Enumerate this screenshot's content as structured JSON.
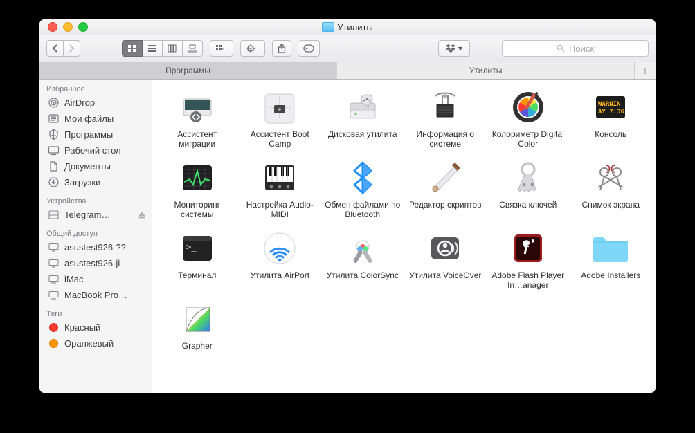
{
  "window_title": "Утилиты",
  "search": {
    "placeholder": "Поиск"
  },
  "tabs": [
    {
      "label": "Программы",
      "active": false
    },
    {
      "label": "Утилиты",
      "active": true
    }
  ],
  "sidebar": {
    "sections": [
      {
        "title": "Избранное",
        "items": [
          {
            "icon": "airdrop",
            "label": "AirDrop"
          },
          {
            "icon": "myfiles",
            "label": "Мои файлы"
          },
          {
            "icon": "apps",
            "label": "Программы"
          },
          {
            "icon": "desktop",
            "label": "Рабочий стол"
          },
          {
            "icon": "docs",
            "label": "Документы"
          },
          {
            "icon": "downloads",
            "label": "Загрузки"
          }
        ]
      },
      {
        "title": "Устройства",
        "items": [
          {
            "icon": "disk",
            "label": "Telegram…",
            "eject": true
          }
        ]
      },
      {
        "title": "Общий доступ",
        "items": [
          {
            "icon": "host",
            "label": "asustest926-??"
          },
          {
            "icon": "host",
            "label": "asustest926-ji"
          },
          {
            "icon": "mac",
            "label": "iMac"
          },
          {
            "icon": "mac",
            "label": "MacBook Pro…"
          }
        ]
      },
      {
        "title": "Теги",
        "items": [
          {
            "icon": "tag",
            "color": "#ff3b30",
            "label": "Красный"
          },
          {
            "icon": "tag",
            "color": "#ff9500",
            "label": "Оранжевый"
          }
        ]
      }
    ]
  },
  "files": [
    {
      "name": "Ассистент миграции",
      "icon": "migration"
    },
    {
      "name": "Ассистент Boot Camp",
      "icon": "bootcamp"
    },
    {
      "name": "Дисковая утилита",
      "icon": "diskutil"
    },
    {
      "name": "Информация о системе",
      "icon": "sysinfo"
    },
    {
      "name": "Колориметр Digital Color",
      "icon": "colorimeter"
    },
    {
      "name": "Консоль",
      "icon": "console"
    },
    {
      "name": "Мониторинг системы",
      "icon": "activity"
    },
    {
      "name": "Настройка Audio-MIDI",
      "icon": "audiomidi"
    },
    {
      "name": "Обмен файлами по Bluetooth",
      "icon": "bluetooth"
    },
    {
      "name": "Редактор скриптов",
      "icon": "script"
    },
    {
      "name": "Связка ключей",
      "icon": "keychain"
    },
    {
      "name": "Снимок экрана",
      "icon": "grab"
    },
    {
      "name": "Терминал",
      "icon": "terminal"
    },
    {
      "name": "Утилита AirPort",
      "icon": "airport"
    },
    {
      "name": "Утилита ColorSync",
      "icon": "colorsync"
    },
    {
      "name": "Утилита VoiceOver",
      "icon": "voiceover"
    },
    {
      "name": "Adobe Flash Player In…anager",
      "icon": "flash"
    },
    {
      "name": "Adobe Installers",
      "icon": "folder"
    },
    {
      "name": "Grapher",
      "icon": "grapher"
    }
  ]
}
